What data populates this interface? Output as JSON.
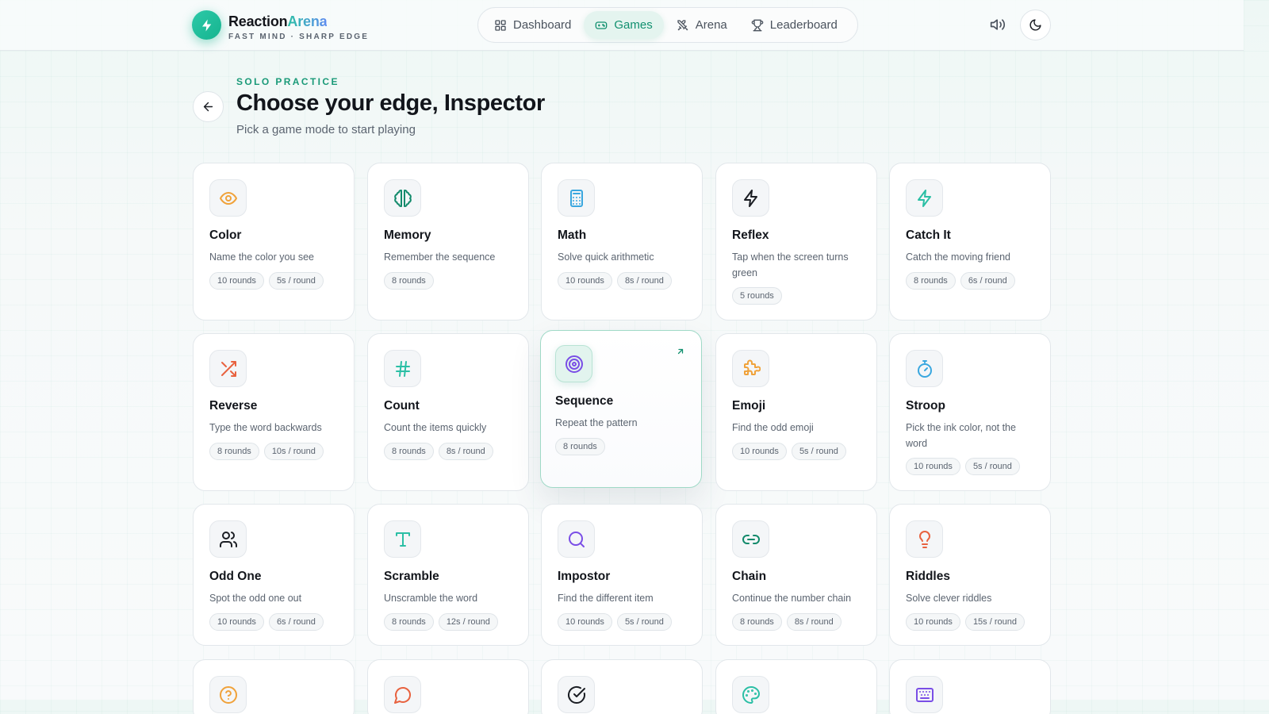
{
  "brand": {
    "name_part1": "Reaction",
    "name_part2": "Arena",
    "tagline": "FAST MIND · SHARP EDGE"
  },
  "nav": [
    {
      "label": "Dashboard",
      "icon": "grid-icon",
      "active": false
    },
    {
      "label": "Games",
      "icon": "gamepad-icon",
      "active": true
    },
    {
      "label": "Arena",
      "icon": "swords-icon",
      "active": false
    },
    {
      "label": "Leaderboard",
      "icon": "trophy-icon",
      "active": false
    }
  ],
  "header": {
    "eyebrow": "SOLO PRACTICE",
    "title": "Choose your edge, Inspector",
    "subtitle": "Pick a game mode to start playing"
  },
  "colors": {
    "accent": "#16b48f",
    "accent_text": "#11906f",
    "orange": "#f0a23a",
    "purple": "#7a4ee6",
    "red": "#e8623f",
    "teal": "#2bbfa5",
    "blue": "#3aa7df"
  },
  "games": [
    {
      "title": "Color",
      "desc": "Name the color you see",
      "tags": [
        "10 rounds",
        "5s / round"
      ],
      "icon": "eye-icon",
      "color": "#f0a23a"
    },
    {
      "title": "Memory",
      "desc": "Remember the sequence",
      "tags": [
        "8 rounds"
      ],
      "icon": "brain-icon",
      "color": "#128a6b"
    },
    {
      "title": "Math",
      "desc": "Solve quick arithmetic",
      "tags": [
        "10 rounds",
        "8s / round"
      ],
      "icon": "calculator-icon",
      "color": "#3aa7df"
    },
    {
      "title": "Reflex",
      "desc": "Tap when the screen turns green",
      "tags": [
        "5 rounds"
      ],
      "icon": "zap-icon",
      "color": "#1b1e24"
    },
    {
      "title": "Catch It",
      "desc": "Catch the moving friend",
      "tags": [
        "8 rounds",
        "6s / round"
      ],
      "icon": "zap-icon",
      "color": "#2bbfa5"
    },
    {
      "title": "Reverse",
      "desc": "Type the word backwards",
      "tags": [
        "8 rounds",
        "10s / round"
      ],
      "icon": "shuffle-icon",
      "color": "#e8623f"
    },
    {
      "title": "Count",
      "desc": "Count the items quickly",
      "tags": [
        "8 rounds",
        "8s / round"
      ],
      "icon": "hash-icon",
      "color": "#2bbfa5"
    },
    {
      "title": "Sequence",
      "desc": "Repeat the pattern",
      "tags": [
        "8 rounds"
      ],
      "icon": "target-icon",
      "color": "#7a4ee6"
    },
    {
      "title": "Emoji",
      "desc": "Find the odd emoji",
      "tags": [
        "10 rounds",
        "5s / round"
      ],
      "icon": "puzzle-icon",
      "color": "#f0a23a"
    },
    {
      "title": "Stroop",
      "desc": "Pick the ink color, not the word",
      "tags": [
        "10 rounds",
        "5s / round"
      ],
      "icon": "timer-icon",
      "color": "#3aa7df"
    },
    {
      "title": "Odd One",
      "desc": "Spot the odd one out",
      "tags": [
        "10 rounds",
        "6s / round"
      ],
      "icon": "users-icon",
      "color": "#1b1e24"
    },
    {
      "title": "Scramble",
      "desc": "Unscramble the word",
      "tags": [
        "8 rounds",
        "12s / round"
      ],
      "icon": "type-icon",
      "color": "#2bbfa5"
    },
    {
      "title": "Impostor",
      "desc": "Find the different item",
      "tags": [
        "10 rounds",
        "5s / round"
      ],
      "icon": "search-icon",
      "color": "#7a4ee6"
    },
    {
      "title": "Chain",
      "desc": "Continue the number chain",
      "tags": [
        "8 rounds",
        "8s / round"
      ],
      "icon": "link-icon",
      "color": "#128a6b"
    },
    {
      "title": "Riddles",
      "desc": "Solve clever riddles",
      "tags": [
        "10 rounds",
        "15s / round"
      ],
      "icon": "lightbulb-icon",
      "color": "#e8623f"
    },
    {
      "title": "",
      "desc": "",
      "tags": [],
      "icon": "help-circle-icon",
      "color": "#f0a23a"
    },
    {
      "title": "",
      "desc": "",
      "tags": [],
      "icon": "message-circle-icon",
      "color": "#e8623f"
    },
    {
      "title": "",
      "desc": "",
      "tags": [],
      "icon": "check-circle-icon",
      "color": "#1b1e24"
    },
    {
      "title": "",
      "desc": "",
      "tags": [],
      "icon": "palette-icon",
      "color": "#2bbfa5"
    },
    {
      "title": "",
      "desc": "",
      "tags": [],
      "icon": "keyboard-icon",
      "color": "#7a4ee6"
    }
  ]
}
